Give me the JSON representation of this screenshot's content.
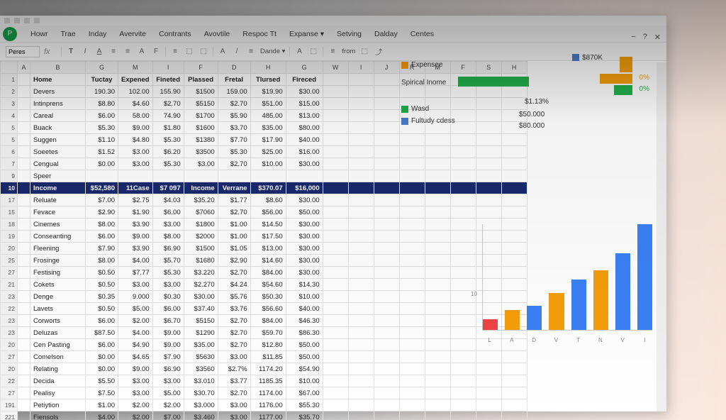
{
  "app_icon_letter": "P",
  "menu": [
    "Howr",
    "Trae",
    "Inday",
    "Avervite",
    "Contrants",
    "Avovtile",
    "Respoc Tt",
    "Expanse ▾",
    "Setving",
    "Dalday",
    "Centes"
  ],
  "winctrl": {
    "min": "−",
    "q": "?",
    "close": "✕"
  },
  "namebox_value": "Peres",
  "toolbar_items": [
    "T",
    "I",
    "A",
    "≡",
    "≡",
    "A",
    "F",
    "≡",
    "⬚",
    "⬚",
    "A",
    "/",
    "≡",
    "Dande ▾",
    "A",
    "⬚",
    "≡",
    "from",
    "⬚",
    "⤴"
  ],
  "col_headers": [
    "A",
    "B",
    "G",
    "M",
    "I",
    "F",
    "D",
    "H",
    "G",
    "W",
    "I",
    "J",
    "R",
    "M",
    "F",
    "S",
    "H"
  ],
  "table_headers": [
    "Home",
    "Tuctay",
    "Expened",
    "Fineted",
    "Plassed",
    "Fretal",
    "Tlursed",
    "Fireced"
  ],
  "rows": [
    {
      "n": "2",
      "a": "Devers",
      "v": [
        "190.30",
        "102.00",
        "155.90",
        "$1500",
        "159.00",
        "$19.90",
        "$30.00"
      ]
    },
    {
      "n": "3",
      "a": "Intinprens",
      "v": [
        "$8.80",
        "$4.60",
        "$2.70",
        "$5150",
        "$2.70",
        "$51.00",
        "$15.00"
      ]
    },
    {
      "n": "4",
      "a": "Careal",
      "v": [
        "$6.00",
        "58.00",
        "74.90",
        "$1700",
        "$5.90",
        "485.00",
        "$13.00"
      ]
    },
    {
      "n": "5",
      "a": "Buack",
      "v": [
        "$5.30",
        "$9.00",
        "$1.80",
        "$1600",
        "$3.70",
        "$35.00",
        "$80.00"
      ]
    },
    {
      "n": "5",
      "a": "Suggen",
      "v": [
        "$1.10",
        "$4.80",
        "$5.30",
        "$1380",
        "$7.70",
        "$17.90",
        "$40.00"
      ]
    },
    {
      "n": "6",
      "a": "Soeetes",
      "v": [
        "$1.52",
        "$3.00",
        "$6.20",
        "$3500",
        "$5.30",
        "$25.00",
        "$16.00"
      ]
    },
    {
      "n": "7",
      "a": "Cengual",
      "v": [
        "$0.00",
        "$3.00",
        "$5.30",
        "$3.00",
        "$2.70",
        "$10.00",
        "$30.00"
      ]
    },
    {
      "n": "9",
      "a": "Speer",
      "v": [
        "",
        "",
        "",
        "",
        "",
        "",
        ""
      ]
    }
  ],
  "highlight_row": {
    "n": "10",
    "a": "Income",
    "v": [
      "$52,580",
      "11Case",
      "$7 097",
      "Income",
      "Verrane",
      "$370.07",
      "$16,000"
    ]
  },
  "rows2": [
    {
      "n": "17",
      "a": "Reluate",
      "v": [
        "$7.00",
        "$2.75",
        "$4.03",
        "$35.20",
        "$1.77",
        "$8.60",
        "$30.00"
      ]
    },
    {
      "n": "15",
      "a": "Fevace",
      "v": [
        "$2.90",
        "$1.90",
        "$6.00",
        "$7060",
        "$2.70",
        "$56.00",
        "$50.00"
      ]
    },
    {
      "n": "18",
      "a": "Cinemes",
      "v": [
        "$8.00",
        "$3.90",
        "$3.00",
        "$1800",
        "$1.00",
        "$14.50",
        "$30.00"
      ]
    },
    {
      "n": "19",
      "a": "Conseanting",
      "v": [
        "$6.00",
        "$9.00",
        "$8.00",
        "$2000",
        "$1.00",
        "$17.50",
        "$30.00"
      ]
    },
    {
      "n": "20",
      "a": "Fleening",
      "v": [
        "$7.90",
        "$3.90",
        "$6.90",
        "$1500",
        "$1.05",
        "$13.00",
        "$30.00"
      ]
    },
    {
      "n": "25",
      "a": "Frosinge",
      "v": [
        "$8.00",
        "$4.00",
        "$5.70",
        "$1680",
        "$2.90",
        "$14.60",
        "$30.00"
      ]
    },
    {
      "n": "27",
      "a": "Festising",
      "v": [
        "$0.50",
        "$7.77",
        "$5.30",
        "$3.220",
        "$2.70",
        "$84.00",
        "$30.00"
      ]
    },
    {
      "n": "21",
      "a": "Cokets",
      "v": [
        "$0.50",
        "$3.00",
        "$3.00",
        "$2.270",
        "$4.24",
        "$54.60",
        "$14.30"
      ]
    },
    {
      "n": "23",
      "a": "Denge",
      "v": [
        "$0.35",
        "9.000",
        "$0.30",
        "$30.00",
        "$5.76",
        "$50.30",
        "$10.00"
      ]
    },
    {
      "n": "22",
      "a": "Lavets",
      "v": [
        "$0.50",
        "$5.00",
        "$6.00",
        "$37.40",
        "$3.76",
        "$56.60",
        "$40.00"
      ]
    },
    {
      "n": "23",
      "a": "Corworts",
      "v": [
        "$6.00",
        "$2.00",
        "$6.70",
        "$5150",
        "$2.70",
        "$84.00",
        "$46.30"
      ]
    },
    {
      "n": "23",
      "a": "Deluzas",
      "v": [
        "$87.50",
        "$4.00",
        "$9.00",
        "$1290",
        "$2.70",
        "$59.70",
        "$86.30"
      ]
    },
    {
      "n": "20",
      "a": "Cen Pasting",
      "v": [
        "$6.00",
        "$4.90",
        "$9.00",
        "$35.00",
        "$2.70",
        "$12.80",
        "$50.00"
      ]
    },
    {
      "n": "27",
      "a": "Comelson",
      "v": [
        "$0.00",
        "$4.65",
        "$7.90",
        "$5630",
        "$3.00",
        "$11.85",
        "$50.00"
      ]
    },
    {
      "n": "20",
      "a": "Relating",
      "v": [
        "$0.00",
        "$9.00",
        "$6.90",
        "$3560",
        "$2.7%",
        "1174.20",
        "$54.90"
      ]
    },
    {
      "n": "22",
      "a": "Decida",
      "v": [
        "$5.50",
        "$3.00",
        "$3.00",
        "$3.010",
        "$3.77",
        "1185.35",
        "$10.00"
      ]
    },
    {
      "n": "27",
      "a": "Pealisy",
      "v": [
        "$7.50",
        "$3.00",
        "$5.00",
        "$30.70",
        "$2.70",
        "1174.00",
        "$67.00"
      ]
    },
    {
      "n": "191",
      "a": "Petiytion",
      "v": [
        "$1.00",
        "$2.00",
        "$2.00",
        "$3.000",
        "$3.00",
        "1176.00",
        "$55.30"
      ]
    },
    {
      "n": "221",
      "a": "Fiensols",
      "v": [
        "$4.00",
        "$2.00",
        "$7.00",
        "$3.460",
        "$3.00",
        "1177.00",
        "$35.70"
      ]
    }
  ],
  "chart_data": [
    {
      "type": "bar-horizontal",
      "title": "",
      "legend": [
        {
          "label": "Expensee",
          "color": "#f59e0b"
        },
        {
          "label": "Spirical Inome",
          "color": "#22b14c"
        },
        {
          "label": "Wasd",
          "color": "#22b14c"
        },
        {
          "label": "Fultudy cdess",
          "color": "#4a7ec9"
        }
      ],
      "right_badge": {
        "label": "$870K",
        "color": "#4a7ec9"
      },
      "right_values": [
        "$1.13%",
        "$50.000",
        "$80.000"
      ],
      "right_pct": [
        "0%",
        "0%"
      ]
    },
    {
      "type": "bar",
      "categories": [
        "L",
        "A",
        "D",
        "V",
        "T",
        "N",
        "V",
        "I"
      ],
      "series": [
        {
          "name": "",
          "values": [
            8,
            15,
            18,
            28,
            38,
            45,
            58,
            80
          ],
          "colors": [
            "#ef4444",
            "#f59e0b",
            "#3b82f6",
            "#f59e0b",
            "#3b82f6",
            "#f59e0b",
            "#3b82f6",
            "#3b82f6"
          ]
        }
      ],
      "ylim": [
        0,
        80
      ],
      "yticks": [
        "",
        "10",
        "",
        "",
        ""
      ],
      "title": ""
    }
  ]
}
